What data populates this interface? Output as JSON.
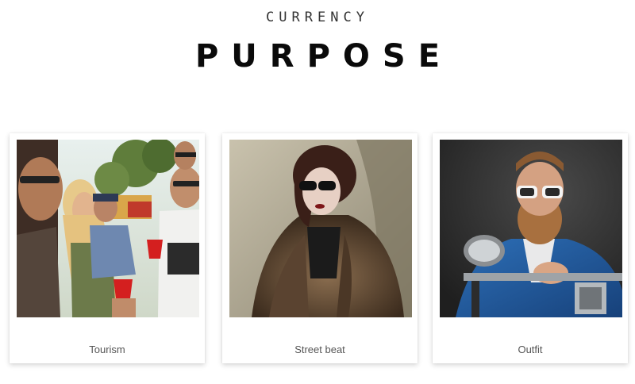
{
  "header": {
    "eyebrow": "CURRENCY",
    "title": "PURPOSE"
  },
  "cards": [
    {
      "caption": "Tourism",
      "image": "friends-party-sunglasses-photo"
    },
    {
      "caption": "Street beat",
      "image": "woman-fur-coat-sunglasses-photo"
    },
    {
      "caption": "Outfit",
      "image": "bearded-man-motorcycle-sunglasses-photo"
    }
  ],
  "colors": {
    "background": "#ffffff",
    "title": "#0a0a0a",
    "caption": "#555555"
  }
}
